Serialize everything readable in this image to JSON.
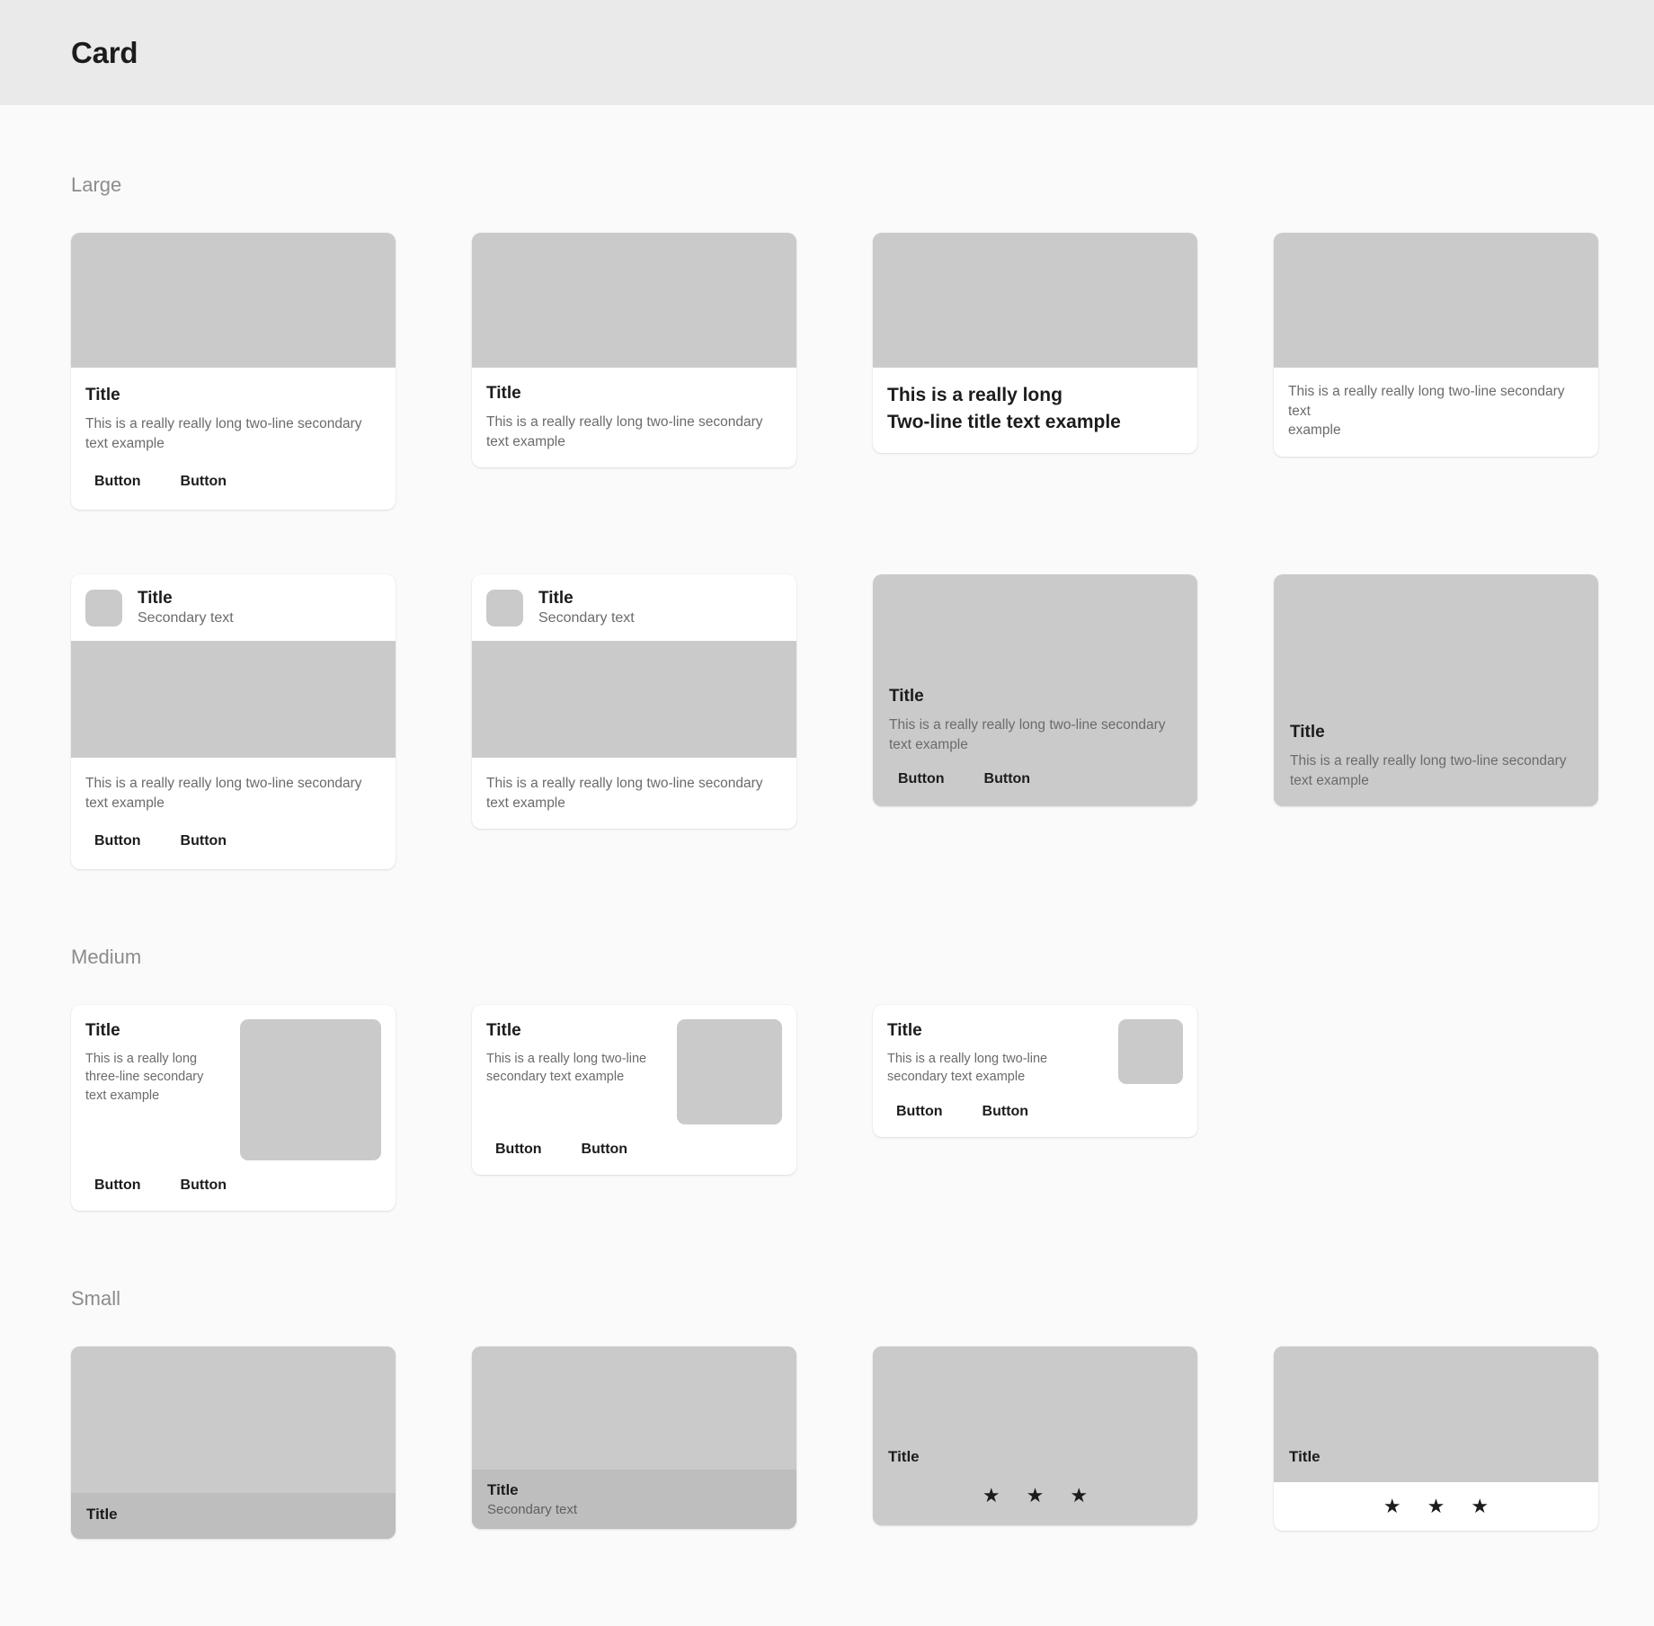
{
  "header": {
    "title": "Card"
  },
  "sections": [
    {
      "label": "Large"
    },
    {
      "label": "Medium"
    },
    {
      "label": "Small"
    }
  ],
  "text": {
    "title": "Title",
    "secondary_two_line": "This is a really really long two-line secondary text example",
    "secondary_two_line_break": "This is a really really long two-line secondary text\nexample",
    "secondary_text": "Secondary text",
    "long_title_line1": "This is a really long",
    "long_title_line2": "Two-line title text example",
    "secondary_three_line": "This is a really long three-line secondary text example",
    "secondary_med_two_line": "This is a really long two-line secondary text example",
    "button": "Button",
    "star": "★"
  },
  "large": {
    "card1": {
      "title": "Title",
      "secondary": "This is a really really long two-line secondary text example",
      "button1": "Button",
      "button2": "Button"
    },
    "card2": {
      "title": "Title",
      "secondary": "This is a really really long two-line secondary text example"
    },
    "card3": {
      "title_line1": "This is a really long",
      "title_line2": "Two-line title text example"
    },
    "card4": {
      "secondary_line1": "This is a really really long two-line secondary text",
      "secondary_line2": "example"
    },
    "card5": {
      "title": "Title",
      "subtitle": "Secondary text",
      "secondary": "This is a really really long two-line secondary text example",
      "button1": "Button",
      "button2": "Button"
    },
    "card6": {
      "title": "Title",
      "subtitle": "Secondary text",
      "secondary": "This is a really really long two-line secondary text example"
    },
    "card7": {
      "title": "Title",
      "secondary": "This is a really really long two-line secondary text example",
      "button1": "Button",
      "button2": "Button"
    },
    "card8": {
      "title": "Title",
      "secondary": "This is a really really long two-line secondary text example"
    }
  },
  "medium": {
    "card1": {
      "title": "Title",
      "secondary": "This is a really long three-line secondary text example",
      "button1": "Button",
      "button2": "Button"
    },
    "card2": {
      "title": "Title",
      "secondary": "This is a really long two-line secondary text example",
      "button1": "Button",
      "button2": "Button"
    },
    "card3": {
      "title": "Title",
      "secondary": "This is a really long two-line secondary text example",
      "button1": "Button",
      "button2": "Button"
    }
  },
  "small": {
    "card1": {
      "title": "Title"
    },
    "card2": {
      "title": "Title",
      "subtitle": "Secondary text"
    },
    "card3": {
      "title": "Title",
      "star1": "★",
      "star2": "★",
      "star3": "★"
    },
    "card4": {
      "title": "Title",
      "star1": "★",
      "star2": "★",
      "star3": "★"
    }
  },
  "colors": {
    "header_bg": "#eaeaea",
    "page_bg": "#fafafa",
    "media_gray": "#cacaca",
    "bar_gray": "#bebebe",
    "text_primary": "#1c1c1c",
    "text_secondary": "#6b6b6b",
    "section_label": "#8c8c8c"
  }
}
